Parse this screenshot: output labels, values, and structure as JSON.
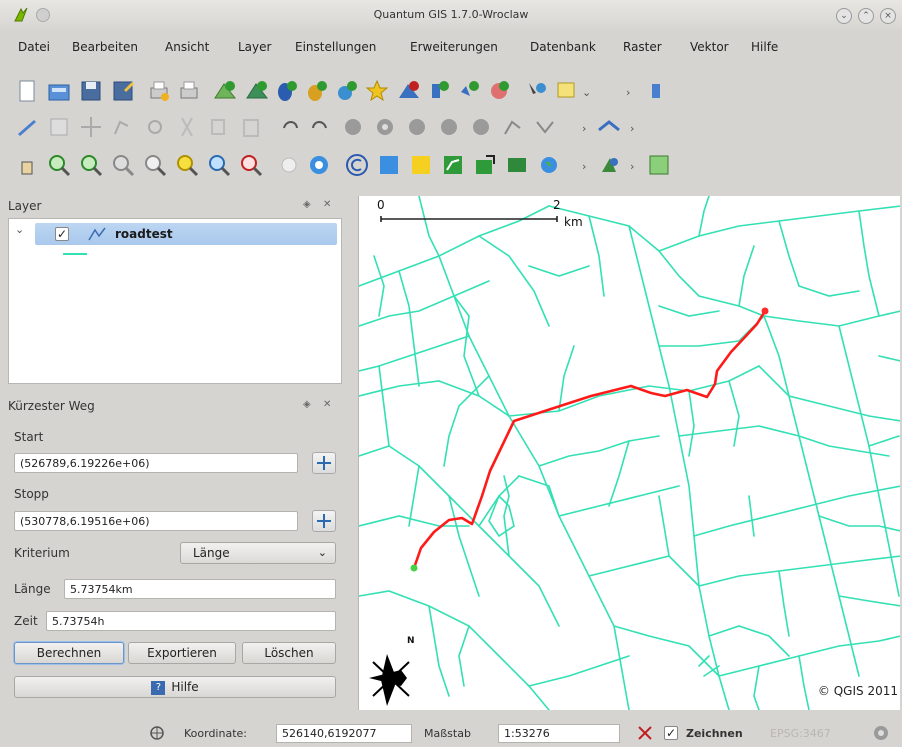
{
  "window": {
    "title": "Quantum GIS 1.7.0-Wroclaw"
  },
  "menubar": [
    "Datei",
    "Bearbeiten",
    "Ansicht",
    "Layer",
    "Einstellungen",
    "Erweiterungen",
    "Datenbank",
    "Raster",
    "Vektor",
    "Hilfe"
  ],
  "layer_panel": {
    "title": "Layer",
    "layer": {
      "name": "roadtest",
      "checked": true
    }
  },
  "shortest_path": {
    "title": "Kürzester Weg",
    "start_label": "Start",
    "start_value": "(526789,6.19226e+06)",
    "stop_label": "Stopp",
    "stop_value": "(530778,6.19516e+06)",
    "criterion_label": "Kriterium",
    "criterion_value": "Länge",
    "length_label": "Länge",
    "length_value": "5.73754km",
    "time_label": "Zeit",
    "time_value": "5.73754h",
    "calc_button": "Berechnen",
    "export_button": "Exportieren",
    "clear_button": "Löschen",
    "help_button": "Hilfe"
  },
  "map": {
    "scale_left": "0",
    "scale_right": "2",
    "scale_unit": "km",
    "north_label": "N",
    "copyright": "© QGIS 2011",
    "road_color": "#33e0b4",
    "route_color": "#ff1a1a"
  },
  "statusbar": {
    "coord_label": "Koordinate:",
    "coord_value": "526140,6192077",
    "scale_label": "Maßstab",
    "scale_value": "1:53276",
    "render_label": "Zeichnen",
    "epsg": "EPSG:3467"
  }
}
